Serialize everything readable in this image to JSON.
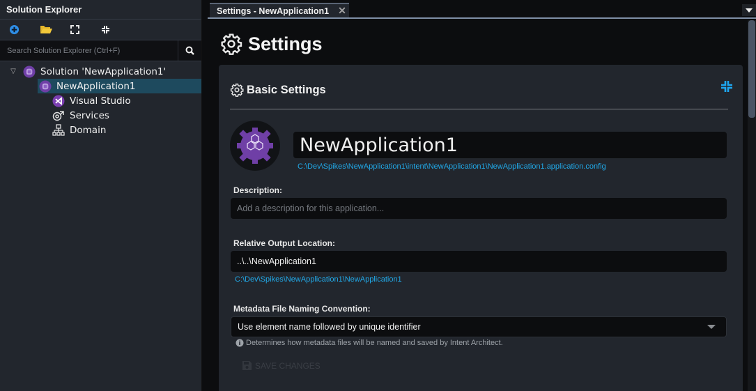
{
  "sidebar": {
    "title": "Solution Explorer",
    "toolbar": [
      {
        "name": "add-icon",
        "tooltip": ""
      },
      {
        "name": "open-folder-icon",
        "tooltip": ""
      },
      {
        "name": "expand-icon",
        "tooltip": ""
      },
      {
        "name": "collapse-icon",
        "tooltip": ""
      }
    ],
    "search": {
      "placeholder": "Search Solution Explorer (Ctrl+F)",
      "value": ""
    },
    "tree": [
      {
        "label": "Solution 'NewApplication1'",
        "level": 0,
        "icon": "solution-icon",
        "expanded": true,
        "selected": false
      },
      {
        "label": "NewApplication1",
        "level": 1,
        "icon": "application-icon",
        "expanded": true,
        "selected": true
      },
      {
        "label": "Visual Studio",
        "level": 2,
        "icon": "visual-studio-icon"
      },
      {
        "label": "Services",
        "level": 2,
        "icon": "services-icon"
      },
      {
        "label": "Domain",
        "level": 2,
        "icon": "domain-icon"
      }
    ]
  },
  "tabs": [
    {
      "label": "Settings - NewApplication1",
      "active": true,
      "close": "✕"
    }
  ],
  "page": {
    "title": "Settings",
    "section": {
      "title": "Basic Settings",
      "app_name": "NewApplication1",
      "config_path": "C:\\Dev\\Spikes\\NewApplication1\\intent\\NewApplication1\\NewApplication1.application.config",
      "description": {
        "label": "Description:",
        "placeholder": "Add a description for this application...",
        "value": ""
      },
      "output_location": {
        "label": "Relative Output Location:",
        "value": "..\\..\\NewApplication1",
        "resolved_path": "C:\\Dev\\Spikes\\NewApplication1\\NewApplication1"
      },
      "naming_convention": {
        "label": "Metadata File Naming Convention:",
        "selected": "Use element name followed by unique identifier",
        "hint": "Determines how metadata files will be named and saved by Intent Architect."
      },
      "save_label": "SAVE CHANGES"
    }
  },
  "colors": {
    "accent": "#21a9e8",
    "selection": "#1e4a5e",
    "app_purple": "#6f3fa6"
  }
}
